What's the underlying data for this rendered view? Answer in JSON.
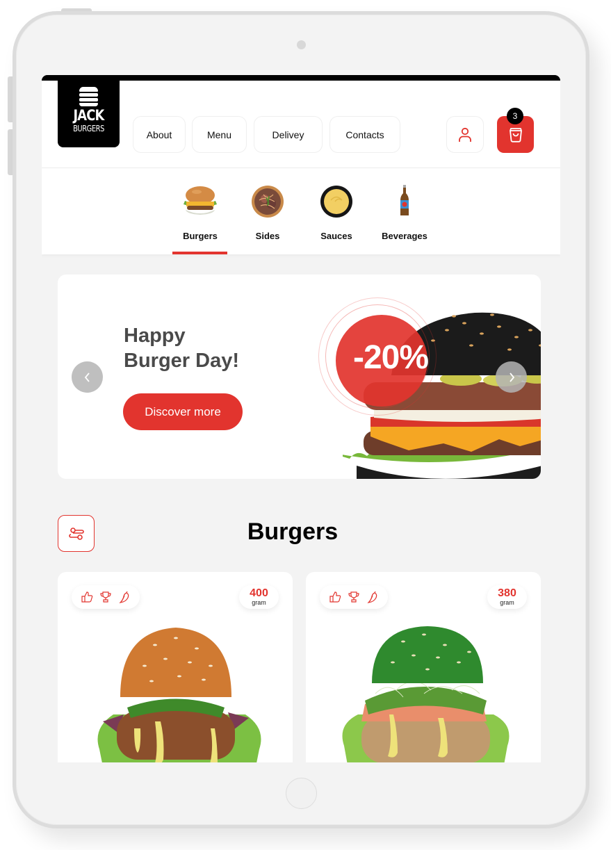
{
  "brand": {
    "name_line1": "JACK",
    "name_line2": "BURGERS"
  },
  "nav": {
    "items": [
      {
        "label": "About"
      },
      {
        "label": "Menu"
      },
      {
        "label": "Delivey"
      },
      {
        "label": "Contacts"
      }
    ],
    "account_icon": "user-icon",
    "cart_icon": "shopping-bag-icon",
    "cart_count": "3"
  },
  "categories": {
    "active": "Burgers",
    "items": [
      {
        "label": "Burgers",
        "icon": "burger-image"
      },
      {
        "label": "Sides",
        "icon": "salad-bowl-image"
      },
      {
        "label": "Sauces",
        "icon": "sauce-bowl-image"
      },
      {
        "label": "Beverages",
        "icon": "bottle-image"
      }
    ]
  },
  "banner": {
    "title_line1": "Happy",
    "title_line2": "Burger Day!",
    "cta_label": "Discover more",
    "discount": "-20%",
    "prev_icon": "chevron-left-icon",
    "next_icon": "chevron-right-icon"
  },
  "section": {
    "title": "Burgers",
    "filter_icon": "filter-sliders-icon"
  },
  "products": [
    {
      "weight": "400",
      "unit": "gram",
      "badges": [
        "thumbs-up-icon",
        "trophy-icon",
        "chili-pepper-icon"
      ],
      "bun": "sesame"
    },
    {
      "weight": "380",
      "unit": "gram",
      "badges": [
        "thumbs-up-icon",
        "trophy-icon",
        "chili-pepper-icon"
      ],
      "bun": "green"
    }
  ],
  "colors": {
    "accent": "#e2342e",
    "dark": "#000000",
    "background": "#f3f3f3"
  }
}
